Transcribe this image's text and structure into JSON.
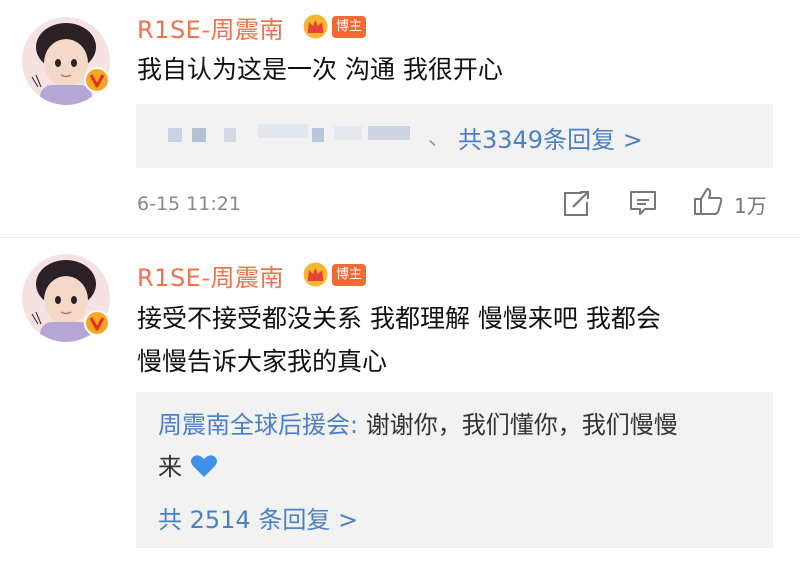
{
  "comments": [
    {
      "username": "R1SE-周震南",
      "badge": "博主",
      "text": "我自认为这是一次 沟通 我很开心",
      "reply_suffix": "、",
      "reply_count_label": "共3349条回复 >",
      "timestamp": "6-15 11:21",
      "likes": "1万"
    },
    {
      "username": "R1SE-周震南",
      "badge": "博主",
      "text_line1": "接受不接受都没关系 我都理解 慢慢来吧 我都会",
      "text_line2": "慢慢告诉大家我的真心",
      "reply_author": "周震南全球后援会:",
      "reply_text_line1": " 谢谢你，我们懂你，我们慢慢",
      "reply_text_line2": "来",
      "reply_emoji": "💙",
      "reply_count_label": "共 2514 条回复 >"
    }
  ],
  "icons": [
    "share-icon",
    "comment-icon",
    "like-icon",
    "crown-vip-icon",
    "verified-v-icon"
  ],
  "colors": {
    "username": "#eb7350",
    "link": "#4a80c8",
    "badge": "#f06a34",
    "verified": "#f5a623"
  }
}
